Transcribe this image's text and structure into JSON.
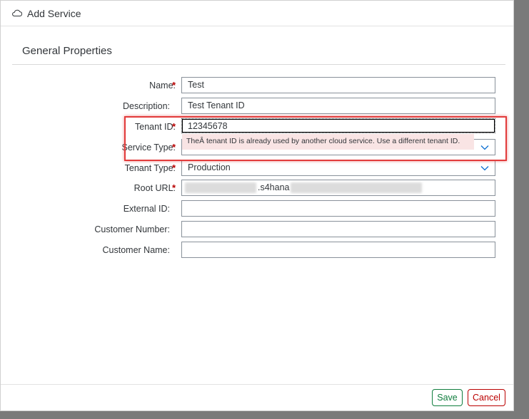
{
  "dialog": {
    "title": "Add Service",
    "icon": "cloud-icon"
  },
  "section": {
    "title": "General Properties"
  },
  "fields": [
    {
      "label": "Name:",
      "required": true,
      "value": "Test"
    },
    {
      "label": "Description:",
      "required": false,
      "value": "Test Tenant ID"
    },
    {
      "label": "Tenant ID:",
      "required": true,
      "value": "12345678"
    },
    {
      "label": "Service Type:",
      "required": true,
      "value": ""
    },
    {
      "label": "Tenant Type:",
      "required": true,
      "value": "Production"
    },
    {
      "label": "Root URL:",
      "required": true,
      "value": ".s4hana"
    },
    {
      "label": "External ID:",
      "required": false,
      "value": ""
    },
    {
      "label": "Customer Number:",
      "required": false,
      "value": ""
    },
    {
      "label": "Customer Name:",
      "required": false,
      "value": ""
    }
  ],
  "required_marker": "*",
  "error": {
    "message": "TheÂ tenant ID is already used by another cloud service. Use a different tenant ID."
  },
  "footer": {
    "save_label": "Save",
    "cancel_label": "Cancel"
  },
  "colors": {
    "required": "#bb0000",
    "save": "#107e3e",
    "cancel": "#bb0000",
    "error_bg": "#f9e4e4",
    "annotation": "#e23b3b"
  }
}
